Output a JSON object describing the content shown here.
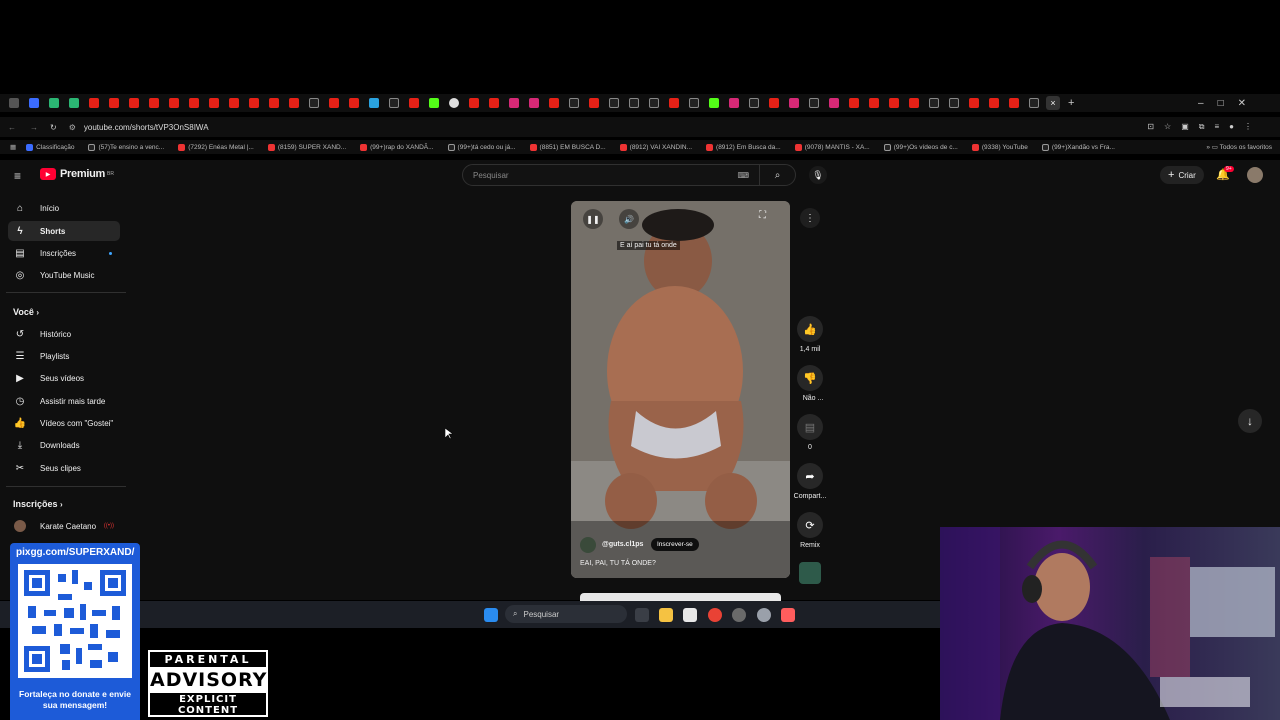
{
  "browser": {
    "url": "youtube.com/shorts/tVP3OnS8IWA",
    "bookmarks": [
      "Classificação",
      "(57)Te ensino a venc...",
      "(7292) Enéas Metal |...",
      "(8159) SUPER XAND...",
      "(99+)rap do XANDÃ...",
      "(99+)tá cedo ou já...",
      "(8851) EM BUSCA D...",
      "(8912) VAI XANDIN...",
      "(8912) Em Busca da...",
      "(9078) MANTIS - XA...",
      "(99+)Os vídeos de c...",
      "(9338) YouTube",
      "(99+)Xandão vs Fra..."
    ],
    "all_bookmarks": "Todos os favoritos"
  },
  "youtube": {
    "logo": "Premium",
    "logo_badge": "BR",
    "search_placeholder": "Pesquisar",
    "create_label": "Criar",
    "notif_count": "9+",
    "sidebar": {
      "main": [
        "Início",
        "Shorts",
        "Inscrições",
        "YouTube Music"
      ],
      "you_title": "Você",
      "you": [
        "Histórico",
        "Playlists",
        "Seus vídeos",
        "Assistir mais tarde",
        "Vídeos com \"Gostei\"",
        "Downloads",
        "Seus clipes"
      ],
      "subs_title": "Inscrições",
      "subs": [
        "Karate Caetano"
      ]
    },
    "short": {
      "caption": "E aí pai tu tá onde",
      "channel": "@guts.cl1ps",
      "subscribe": "Inscrever-se",
      "title": "EAI, PAI, TU TÁ ONDE?"
    },
    "actions": {
      "likes": "1,4 mil",
      "dislike": "Não ...",
      "comments": "0",
      "share": "Compart...",
      "remix": "Remix"
    }
  },
  "taskbar": {
    "search": "Pesquisar"
  },
  "overlay": {
    "qr_url": "pixgg.com/SUPERXAND/",
    "qr_caption": "Fortaleça no donate e envie sua mensagem!",
    "advisory_top": "PARENTAL",
    "advisory_main": "ADVISORY",
    "advisory_bottom": "EXPLICIT CONTENT"
  },
  "colors": {
    "yt_red": "#ff0033",
    "bg": "#0f0f0f",
    "accent_blue": "#3ea6ff"
  }
}
